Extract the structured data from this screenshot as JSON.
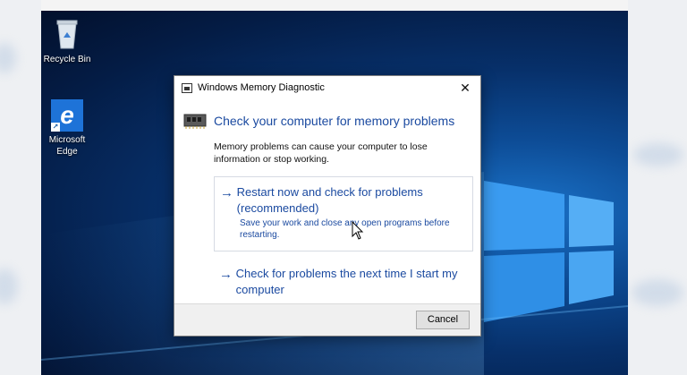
{
  "desktop": {
    "icons": [
      {
        "label": "Recycle Bin",
        "icon": "recycle-bin-icon"
      },
      {
        "label": "Microsoft Edge",
        "icon": "edge-icon",
        "glyph": "e"
      }
    ]
  },
  "dialog": {
    "title": "Windows Memory Diagnostic",
    "close_glyph": "✕",
    "heading": "Check your computer for memory problems",
    "description": "Memory problems can cause your computer to lose information or stop working.",
    "options": [
      {
        "arrow": "→",
        "title": "Restart now and check for problems (recommended)",
        "subtitle": "Save your work and close any open programs before restarting."
      },
      {
        "arrow": "→",
        "title": "Check for problems the next time I start my computer"
      }
    ],
    "cancel_label": "Cancel"
  },
  "colors": {
    "link": "#1b4aa0",
    "desktop_blue": "#0d4c96"
  }
}
